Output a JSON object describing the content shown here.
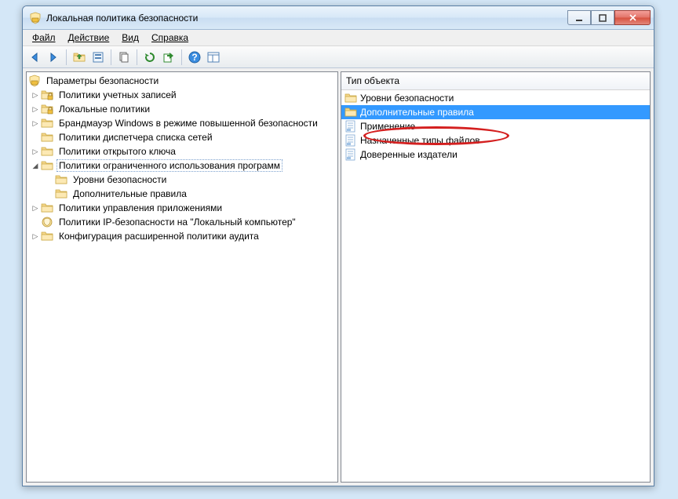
{
  "window": {
    "title": "Локальная политика безопасности"
  },
  "menu": {
    "file": "Файл",
    "action": "Действие",
    "view": "Вид",
    "help": "Справка"
  },
  "tree": {
    "root": "Параметры безопасности",
    "items": [
      {
        "label": "Политики учетных записей",
        "icon": "folder-lock",
        "depth": 1,
        "expander": ">"
      },
      {
        "label": "Локальные политики",
        "icon": "folder-lock",
        "depth": 1,
        "expander": ">"
      },
      {
        "label": "Брандмауэр Windows в режиме повышенной безопасности",
        "icon": "folder",
        "depth": 1,
        "expander": ">"
      },
      {
        "label": "Политики диспетчера списка сетей",
        "icon": "folder",
        "depth": 1,
        "expander": ""
      },
      {
        "label": "Политики открытого ключа",
        "icon": "folder",
        "depth": 1,
        "expander": ">"
      },
      {
        "label": "Политики ограниченного использования программ",
        "icon": "folder",
        "depth": 1,
        "expander": "v",
        "selected": true
      },
      {
        "label": "Уровни безопасности",
        "icon": "folder",
        "depth": 2,
        "expander": ""
      },
      {
        "label": "Дополнительные правила",
        "icon": "folder",
        "depth": 2,
        "expander": ""
      },
      {
        "label": "Политики управления приложениями",
        "icon": "folder",
        "depth": 1,
        "expander": ">"
      },
      {
        "label": "Политики IP-безопасности на \"Локальный компьютер\"",
        "icon": "ip-shield",
        "depth": 1,
        "expander": ""
      },
      {
        "label": "Конфигурация расширенной политики аудита",
        "icon": "folder",
        "depth": 1,
        "expander": ">"
      }
    ]
  },
  "list": {
    "header": "Тип объекта",
    "items": [
      {
        "label": "Уровни безопасности",
        "icon": "folder",
        "selected": false
      },
      {
        "label": "Дополнительные правила",
        "icon": "folder",
        "selected": true
      },
      {
        "label": "Применение",
        "icon": "doc",
        "selected": false
      },
      {
        "label": "Назначенные типы файлов",
        "icon": "doc",
        "selected": false
      },
      {
        "label": "Доверенные издатели",
        "icon": "doc",
        "selected": false
      }
    ]
  }
}
